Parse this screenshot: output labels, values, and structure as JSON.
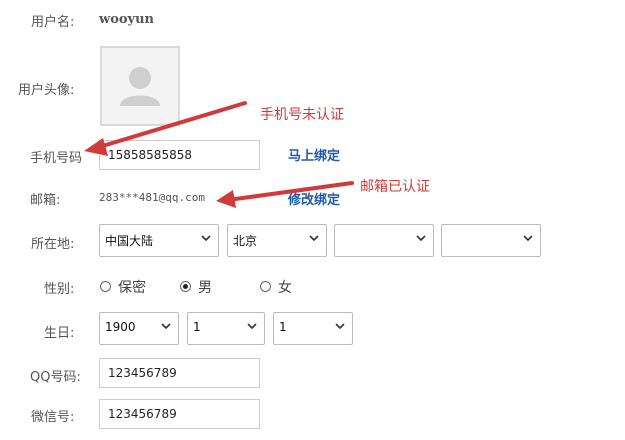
{
  "form": {
    "username": {
      "label": "用户名:",
      "value": "wooyun"
    },
    "avatar": {
      "label": "用户头像:"
    },
    "phone": {
      "label": "手机号码",
      "value": "15858585858",
      "action": "马上绑定"
    },
    "email": {
      "label": "邮箱:",
      "value": "283***481@qq.com",
      "action": "修改绑定"
    },
    "location": {
      "label": "所在地:",
      "country": "中国大陆",
      "province": "北京",
      "city": "",
      "district": ""
    },
    "gender": {
      "label": "性别:",
      "options": [
        "保密",
        "男",
        "女"
      ],
      "selected": "男"
    },
    "birthday": {
      "label": "生日:",
      "year": "1900",
      "month": "1",
      "day": "1"
    },
    "qq": {
      "label": "QQ号码:",
      "value": "123456789"
    },
    "wechat": {
      "label": "微信号:",
      "value": "123456789"
    }
  },
  "annotations": {
    "phone_note": "手机号未认证",
    "email_note": "邮箱已认证"
  },
  "colors": {
    "annotation": "#d23a3a",
    "link": "#1f5aa6"
  }
}
